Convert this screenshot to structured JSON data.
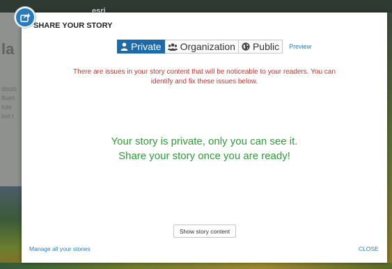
{
  "background": {
    "logo": "esri",
    "title_fragment": "la",
    "text_lines": [
      "douts",
      "fluen",
      "tute",
      "but t"
    ]
  },
  "modal": {
    "title": "SHARE YOUR STORY",
    "tabs": [
      {
        "label": "Private",
        "icon": "user-icon",
        "selected": true
      },
      {
        "label": "Organization",
        "icon": "group-icon",
        "selected": false
      },
      {
        "label": "Public",
        "icon": "globe-icon",
        "selected": false
      }
    ],
    "preview_label": "Preview",
    "warning_lines": [
      "There are issues in your story content that will be noticeable to your readers. You can",
      "identify and fix these issues below."
    ],
    "status_lines": [
      "Your story is private, only you can see it.",
      "Share your story once you are ready!"
    ],
    "show_content_label": "Show story content",
    "manage_label": "Manage all your stories",
    "close_label": "CLOSE"
  },
  "colors": {
    "accent": "#2a7bbb",
    "tab_active": "#1f6aa5",
    "warning": "#c8332e",
    "status_ok": "#2f9b3a"
  }
}
